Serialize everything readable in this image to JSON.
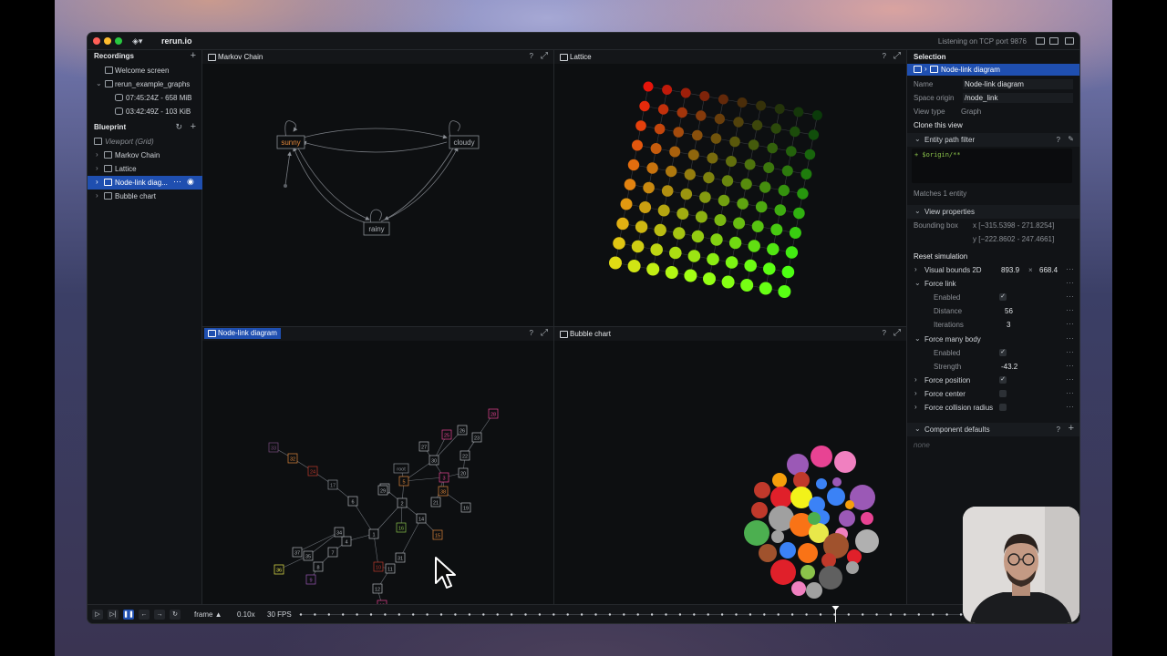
{
  "window": {
    "app_title": "rerun.io",
    "tcp_status": "Listening on TCP port 9876"
  },
  "left_panel": {
    "recordings_title": "Recordings",
    "recordings": [
      {
        "label": "Welcome screen"
      },
      {
        "label": "rerun_example_graphs"
      },
      {
        "label": "07:45:24Z - 658 MiB"
      },
      {
        "label": "03:42:49Z - 103 KiB"
      }
    ],
    "blueprint_title": "Blueprint",
    "blueprint_items": [
      {
        "label": "Viewport (Grid)"
      },
      {
        "label": "Markov Chain"
      },
      {
        "label": "Lattice"
      },
      {
        "label": "Node-link diag..."
      },
      {
        "label": "Bubble chart"
      }
    ]
  },
  "views": {
    "markov": {
      "title": "Markov Chain",
      "nodes": [
        {
          "label": "sunny",
          "color": "#e0873a"
        },
        {
          "label": "cloudy",
          "color": "#aeb2b7"
        },
        {
          "label": "rainy",
          "color": "#aeb2b7"
        }
      ]
    },
    "lattice": {
      "title": "Lattice"
    },
    "nodelink": {
      "title": "Node-link diagram",
      "node_labels": [
        "33",
        "32",
        "24",
        "17",
        "6",
        "5",
        "1",
        "2",
        "3",
        "4",
        "7",
        "8",
        "9",
        "10",
        "11",
        "12",
        "13",
        "14",
        "15",
        "16",
        "18",
        "19",
        "20",
        "21",
        "22",
        "23",
        "25",
        "26",
        "27",
        "28",
        "29",
        "30",
        "31",
        "34",
        "35",
        "36",
        "37",
        "38",
        "root"
      ]
    },
    "bubble": {
      "title": "Bubble chart"
    },
    "help": "?",
    "maximize": "⤢"
  },
  "selection_panel": {
    "title": "Selection",
    "selected_item": "Node-link diagram",
    "name_key": "Name",
    "name_val": "Node-link diagram",
    "space_origin_key": "Space origin",
    "space_origin_val": "/node_link",
    "view_type_key": "View type",
    "view_type_val": "Graph",
    "clone_label": "Clone this view",
    "entity_filter_title": "Entity path filter",
    "entity_filter_text": "+ $origin/**",
    "matches_text": "Matches 1 entity",
    "view_properties_title": "View properties",
    "bounding_box_key": "Bounding box",
    "bounding_box_x": "x [−315.5398 - 271.8254]",
    "bounding_box_y": "y [−222.8602 - 247.4661]",
    "reset_simulation": "Reset simulation",
    "visual_bounds_label": "Visual bounds 2D",
    "visual_bounds_w": "893.9",
    "visual_bounds_x": "×",
    "visual_bounds_h": "668.4",
    "force_link": "Force link",
    "enabled": "Enabled",
    "distance_label": "Distance",
    "distance_val": "56",
    "iterations_label": "Iterations",
    "iterations_val": "3",
    "force_many_body": "Force many body",
    "strength_label": "Strength",
    "strength_val": "-43.2",
    "force_position": "Force position",
    "force_center": "Force center",
    "force_collision": "Force collision radius",
    "component_defaults": "Component defaults",
    "none_text": "none",
    "more": "⋯",
    "check": "✓"
  },
  "timeline": {
    "frame_label": "frame ▲",
    "speed": "0.10x",
    "fps": "30 FPS",
    "progress_fraction": 0.81
  }
}
